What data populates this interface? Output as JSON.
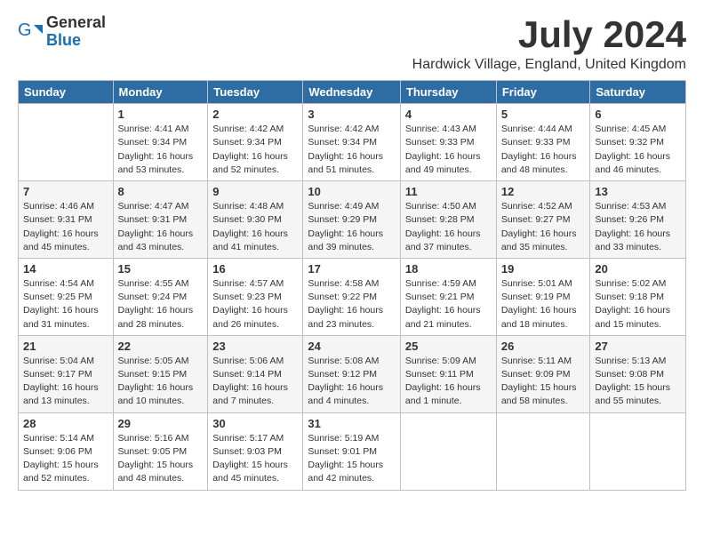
{
  "header": {
    "logo_general": "General",
    "logo_blue": "Blue",
    "month": "July 2024",
    "location": "Hardwick Village, England, United Kingdom"
  },
  "days_of_week": [
    "Sunday",
    "Monday",
    "Tuesday",
    "Wednesday",
    "Thursday",
    "Friday",
    "Saturday"
  ],
  "weeks": [
    [
      {
        "day": "",
        "sunrise": "",
        "sunset": "",
        "daylight": ""
      },
      {
        "day": "1",
        "sunrise": "Sunrise: 4:41 AM",
        "sunset": "Sunset: 9:34 PM",
        "daylight": "Daylight: 16 hours and 53 minutes."
      },
      {
        "day": "2",
        "sunrise": "Sunrise: 4:42 AM",
        "sunset": "Sunset: 9:34 PM",
        "daylight": "Daylight: 16 hours and 52 minutes."
      },
      {
        "day": "3",
        "sunrise": "Sunrise: 4:42 AM",
        "sunset": "Sunset: 9:34 PM",
        "daylight": "Daylight: 16 hours and 51 minutes."
      },
      {
        "day": "4",
        "sunrise": "Sunrise: 4:43 AM",
        "sunset": "Sunset: 9:33 PM",
        "daylight": "Daylight: 16 hours and 49 minutes."
      },
      {
        "day": "5",
        "sunrise": "Sunrise: 4:44 AM",
        "sunset": "Sunset: 9:33 PM",
        "daylight": "Daylight: 16 hours and 48 minutes."
      },
      {
        "day": "6",
        "sunrise": "Sunrise: 4:45 AM",
        "sunset": "Sunset: 9:32 PM",
        "daylight": "Daylight: 16 hours and 46 minutes."
      }
    ],
    [
      {
        "day": "7",
        "sunrise": "Sunrise: 4:46 AM",
        "sunset": "Sunset: 9:31 PM",
        "daylight": "Daylight: 16 hours and 45 minutes."
      },
      {
        "day": "8",
        "sunrise": "Sunrise: 4:47 AM",
        "sunset": "Sunset: 9:31 PM",
        "daylight": "Daylight: 16 hours and 43 minutes."
      },
      {
        "day": "9",
        "sunrise": "Sunrise: 4:48 AM",
        "sunset": "Sunset: 9:30 PM",
        "daylight": "Daylight: 16 hours and 41 minutes."
      },
      {
        "day": "10",
        "sunrise": "Sunrise: 4:49 AM",
        "sunset": "Sunset: 9:29 PM",
        "daylight": "Daylight: 16 hours and 39 minutes."
      },
      {
        "day": "11",
        "sunrise": "Sunrise: 4:50 AM",
        "sunset": "Sunset: 9:28 PM",
        "daylight": "Daylight: 16 hours and 37 minutes."
      },
      {
        "day": "12",
        "sunrise": "Sunrise: 4:52 AM",
        "sunset": "Sunset: 9:27 PM",
        "daylight": "Daylight: 16 hours and 35 minutes."
      },
      {
        "day": "13",
        "sunrise": "Sunrise: 4:53 AM",
        "sunset": "Sunset: 9:26 PM",
        "daylight": "Daylight: 16 hours and 33 minutes."
      }
    ],
    [
      {
        "day": "14",
        "sunrise": "Sunrise: 4:54 AM",
        "sunset": "Sunset: 9:25 PM",
        "daylight": "Daylight: 16 hours and 31 minutes."
      },
      {
        "day": "15",
        "sunrise": "Sunrise: 4:55 AM",
        "sunset": "Sunset: 9:24 PM",
        "daylight": "Daylight: 16 hours and 28 minutes."
      },
      {
        "day": "16",
        "sunrise": "Sunrise: 4:57 AM",
        "sunset": "Sunset: 9:23 PM",
        "daylight": "Daylight: 16 hours and 26 minutes."
      },
      {
        "day": "17",
        "sunrise": "Sunrise: 4:58 AM",
        "sunset": "Sunset: 9:22 PM",
        "daylight": "Daylight: 16 hours and 23 minutes."
      },
      {
        "day": "18",
        "sunrise": "Sunrise: 4:59 AM",
        "sunset": "Sunset: 9:21 PM",
        "daylight": "Daylight: 16 hours and 21 minutes."
      },
      {
        "day": "19",
        "sunrise": "Sunrise: 5:01 AM",
        "sunset": "Sunset: 9:19 PM",
        "daylight": "Daylight: 16 hours and 18 minutes."
      },
      {
        "day": "20",
        "sunrise": "Sunrise: 5:02 AM",
        "sunset": "Sunset: 9:18 PM",
        "daylight": "Daylight: 16 hours and 15 minutes."
      }
    ],
    [
      {
        "day": "21",
        "sunrise": "Sunrise: 5:04 AM",
        "sunset": "Sunset: 9:17 PM",
        "daylight": "Daylight: 16 hours and 13 minutes."
      },
      {
        "day": "22",
        "sunrise": "Sunrise: 5:05 AM",
        "sunset": "Sunset: 9:15 PM",
        "daylight": "Daylight: 16 hours and 10 minutes."
      },
      {
        "day": "23",
        "sunrise": "Sunrise: 5:06 AM",
        "sunset": "Sunset: 9:14 PM",
        "daylight": "Daylight: 16 hours and 7 minutes."
      },
      {
        "day": "24",
        "sunrise": "Sunrise: 5:08 AM",
        "sunset": "Sunset: 9:12 PM",
        "daylight": "Daylight: 16 hours and 4 minutes."
      },
      {
        "day": "25",
        "sunrise": "Sunrise: 5:09 AM",
        "sunset": "Sunset: 9:11 PM",
        "daylight": "Daylight: 16 hours and 1 minute."
      },
      {
        "day": "26",
        "sunrise": "Sunrise: 5:11 AM",
        "sunset": "Sunset: 9:09 PM",
        "daylight": "Daylight: 15 hours and 58 minutes."
      },
      {
        "day": "27",
        "sunrise": "Sunrise: 5:13 AM",
        "sunset": "Sunset: 9:08 PM",
        "daylight": "Daylight: 15 hours and 55 minutes."
      }
    ],
    [
      {
        "day": "28",
        "sunrise": "Sunrise: 5:14 AM",
        "sunset": "Sunset: 9:06 PM",
        "daylight": "Daylight: 15 hours and 52 minutes."
      },
      {
        "day": "29",
        "sunrise": "Sunrise: 5:16 AM",
        "sunset": "Sunset: 9:05 PM",
        "daylight": "Daylight: 15 hours and 48 minutes."
      },
      {
        "day": "30",
        "sunrise": "Sunrise: 5:17 AM",
        "sunset": "Sunset: 9:03 PM",
        "daylight": "Daylight: 15 hours and 45 minutes."
      },
      {
        "day": "31",
        "sunrise": "Sunrise: 5:19 AM",
        "sunset": "Sunset: 9:01 PM",
        "daylight": "Daylight: 15 hours and 42 minutes."
      },
      {
        "day": "",
        "sunrise": "",
        "sunset": "",
        "daylight": ""
      },
      {
        "day": "",
        "sunrise": "",
        "sunset": "",
        "daylight": ""
      },
      {
        "day": "",
        "sunrise": "",
        "sunset": "",
        "daylight": ""
      }
    ]
  ]
}
